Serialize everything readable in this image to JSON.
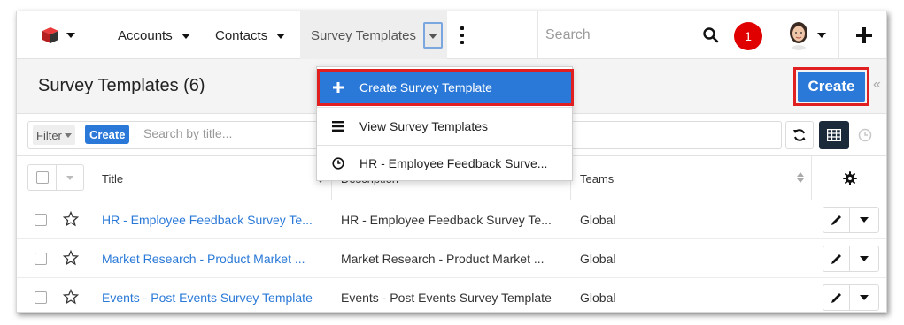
{
  "nav": {
    "items": [
      {
        "label": "Accounts"
      },
      {
        "label": "Contacts"
      },
      {
        "label": "Survey Templates"
      }
    ],
    "search_placeholder": "Search",
    "notification_count": "1"
  },
  "header": {
    "title": "Survey Templates (6)",
    "create_label": "Create"
  },
  "filter": {
    "filter_label": "Filter",
    "create_label": "Create",
    "search_placeholder": "Search by title..."
  },
  "table": {
    "columns": [
      "Title",
      "Description",
      "Teams"
    ],
    "rows": [
      {
        "title": "HR - Employee Feedback Survey Te...",
        "description": "HR - Employee Feedback Survey Te...",
        "teams": "Global"
      },
      {
        "title": "Market Research - Product Market ...",
        "description": "Market Research - Product Market ...",
        "teams": "Global"
      },
      {
        "title": "Events - Post Events Survey Template",
        "description": "Events - Post Events Survey Template",
        "teams": "Global"
      }
    ]
  },
  "dropdown": {
    "items": [
      {
        "label": "Create Survey Template",
        "icon": "plus-icon"
      },
      {
        "label": "View Survey Templates",
        "icon": "list-icon"
      },
      {
        "label": "HR - Employee Feedback Surve...",
        "icon": "clock-icon"
      }
    ]
  },
  "colors": {
    "accent": "#2a79d8",
    "highlight_outline": "#e02020",
    "notification": "#e00000"
  }
}
